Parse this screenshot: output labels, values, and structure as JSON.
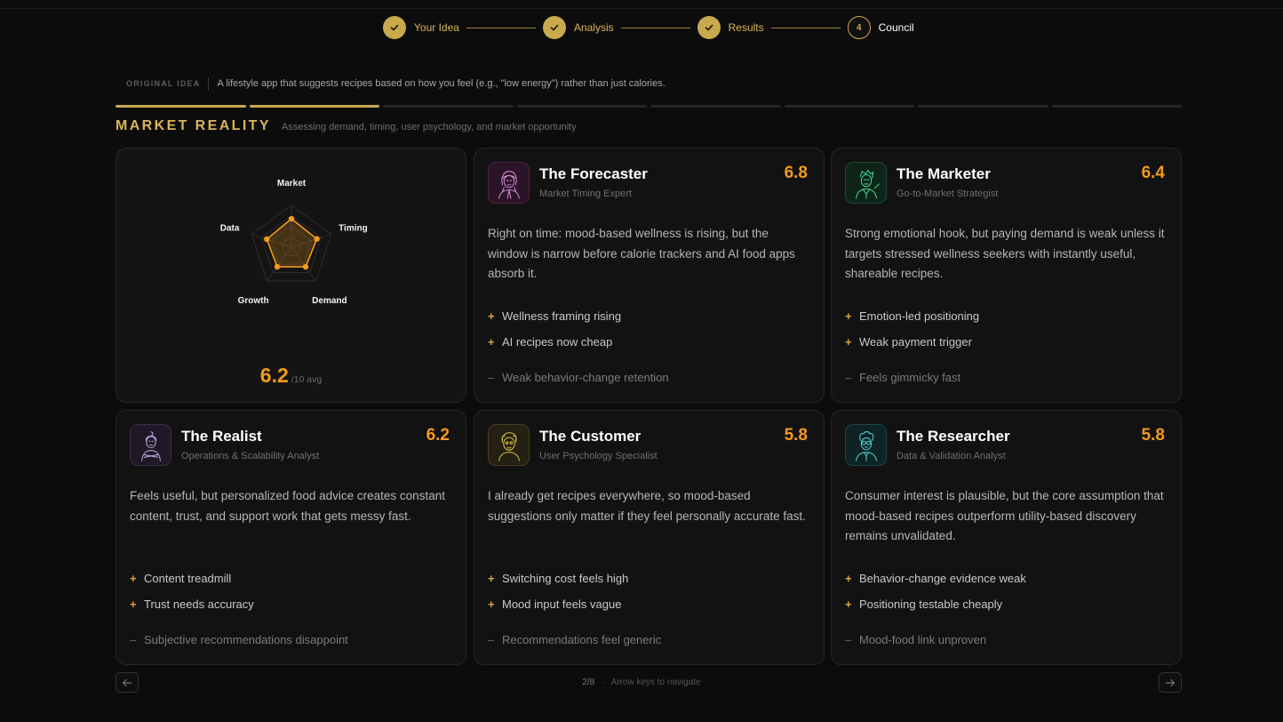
{
  "stepper": {
    "steps": [
      {
        "label": "Your Idea",
        "state": "done"
      },
      {
        "label": "Analysis",
        "state": "done"
      },
      {
        "label": "Results",
        "state": "done"
      },
      {
        "label": "Council",
        "state": "current",
        "number": "4"
      }
    ]
  },
  "idea": {
    "tag": "ORIGINAL IDEA",
    "text": "A lifestyle app that suggests recipes based on how you feel (e.g., \"low energy\") rather than just calories."
  },
  "progress": {
    "segments_total": 8,
    "segments_filled": 2
  },
  "section": {
    "title": "MARKET REALITY",
    "subtitle": "Assessing demand, timing, user psychology, and market opportunity"
  },
  "radar": {
    "axes": [
      "Market",
      "Timing",
      "Demand",
      "Growth",
      "Data"
    ],
    "values": [
      6.8,
      6.4,
      5.8,
      5.8,
      6.2
    ],
    "max": 10,
    "score": "6.2",
    "score_suffix": "/10 avg",
    "accent": "#f39a1c"
  },
  "cards": [
    {
      "name": "The Forecaster",
      "role": "Market Timing Expert",
      "score": "6.8",
      "icon": "woman-portrait-icon",
      "quote": "Right on time: mood-based wellness is rising, but the window is narrow before calorie trackers and AI food apps absorb it.",
      "pros": [
        "Wellness framing rising",
        "AI recipes now cheap"
      ],
      "con": "Weak behavior-change retention"
    },
    {
      "name": "The Marketer",
      "role": "Go-to-Market Strategist",
      "score": "6.4",
      "icon": "man-portrait-icon",
      "quote": "Strong emotional hook, but paying demand is weak unless it targets stressed wellness seekers with instantly useful, shareable recipes.",
      "pros": [
        "Emotion-led positioning",
        "Weak payment trigger"
      ],
      "con": "Feels gimmicky fast"
    },
    {
      "name": "The Realist",
      "role": "Operations & Scalability Analyst",
      "score": "6.2",
      "icon": "woman-arms-crossed-icon",
      "quote": "Feels useful, but personalized food advice creates constant content, trust, and support work that gets messy fast.",
      "pros": [
        "Content treadmill",
        "Trust needs accuracy"
      ],
      "con": "Subjective recommendations disappoint"
    },
    {
      "name": "The Customer",
      "role": "User Psychology Specialist",
      "score": "5.8",
      "icon": "customer-portrait-icon",
      "quote": "I already get recipes everywhere, so mood-based suggestions only matter if they feel personally accurate fast.",
      "pros": [
        "Switching cost feels high",
        "Mood input feels vague"
      ],
      "con": "Recommendations feel generic"
    },
    {
      "name": "The Researcher",
      "role": "Data & Validation Analyst",
      "score": "5.8",
      "icon": "researcher-portrait-icon",
      "quote": "Consumer interest is plausible, but the core assumption that mood-based recipes outperform utility-based discovery remains unvalidated.",
      "pros": [
        "Behavior-change evidence weak",
        "Positioning testable cheaply"
      ],
      "con": "Mood-food link unproven"
    }
  ],
  "footer": {
    "page": "2/8",
    "sep": "·",
    "hint": "Arrow keys to navigate"
  },
  "colors": {
    "gold": "#c9a94b",
    "orange": "#f39a1c",
    "background": "#0c0c0c"
  }
}
